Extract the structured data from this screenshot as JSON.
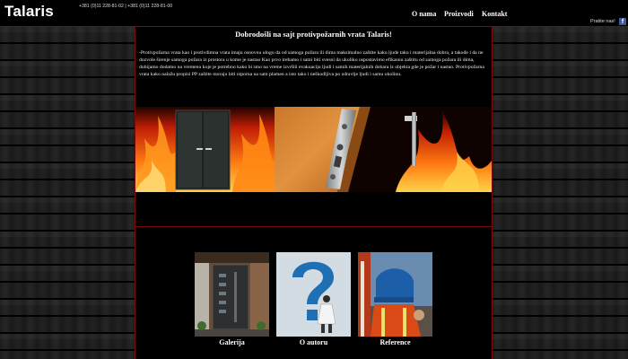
{
  "header": {
    "logo": "Talaris",
    "phones": "+381 (0)11 228-81-02 | +381 (0)11 228-81-00",
    "nav": [
      {
        "label": "O nama"
      },
      {
        "label": "Proizvodi"
      },
      {
        "label": "Kontakt"
      }
    ],
    "follow": "Pratite nas!",
    "facebook_icon": "facebook-icon"
  },
  "main": {
    "welcome": "Dobrodošli na sajt protivpožarnih vrata Talaris!",
    "description": "-Protivpožarna vrata kao i protivdimna vrata imaju osnovnu ulogu da od samoga požara ili dima maksimalno zaštite kako ljude tako i materijalna dobra, a takođe i da ne dozvole širenje samoga požara iz prostora u kome je nastao Kao prvo trebamo i sami biti svesni da ukoliko uspostavimo efikasnu zaštitu od samoga požara ili dima, dobijamo dodatno na vremenu koje je potrebno kako bi smo na vreme izvršili evakuaciju ljudi i samih materijalnih dobara iz objekta gde je požar i nastao. Protivpožarna vrata kako nalažu propisi PP zaštite moraju biti otporna na sam plamen a isto tako i neškodljiva po zdravlje ljudi i samu okolinu.",
    "tiles": [
      {
        "label": "Galerija"
      },
      {
        "label": "O autoru"
      },
      {
        "label": "Reference"
      }
    ]
  },
  "colors": {
    "accent_line": "#7a0a0a",
    "background": "#000000",
    "facebook": "#3b5998"
  }
}
